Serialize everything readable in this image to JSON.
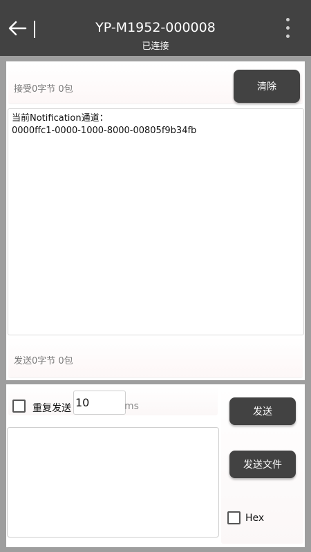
{
  "header": {
    "title": "YP-M1952-000008",
    "status": "已连接"
  },
  "receive": {
    "stats": "接受0字节  0包",
    "clear_label": "清除"
  },
  "log": {
    "line1": "当前Notification通道：",
    "line2": "0000ffc1-0000-1000-8000-00805f9b34fb"
  },
  "send_stats": "发送0字节  0包",
  "repeat": {
    "label": "重复发送",
    "interval": "10",
    "unit": "ms",
    "checked": false
  },
  "send_input": {
    "value": ""
  },
  "actions": {
    "send_label": "发送",
    "send_file_label": "发送文件",
    "hex_label": "Hex",
    "hex_checked": false
  },
  "colors": {
    "toolbar": "#424242",
    "button": "#424242",
    "background": "#9e9e9e"
  },
  "icons": [
    "back-arrow-icon",
    "more-vert-icon"
  ]
}
